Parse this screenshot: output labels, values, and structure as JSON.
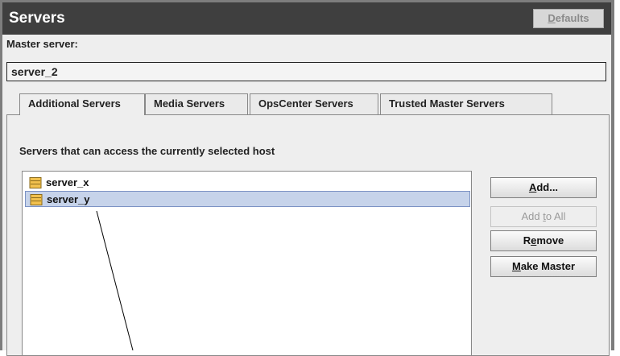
{
  "header": {
    "title": "Servers",
    "defaults_label": "Defaults"
  },
  "master": {
    "label": "Master server:",
    "value": "server_2"
  },
  "tabs": [
    {
      "label": "Additional Servers",
      "active": true
    },
    {
      "label": "Media Servers",
      "active": false
    },
    {
      "label": "OpsCenter Servers",
      "active": false
    },
    {
      "label": "Trusted Master Servers",
      "active": false
    }
  ],
  "description": "Servers that can access the currently selected host",
  "servers": [
    {
      "name": "server_x",
      "icon": "server-icon",
      "selected": false
    },
    {
      "name": "server_y",
      "icon": "server-icon",
      "selected": true
    }
  ],
  "buttons": {
    "add": {
      "label": "Add...",
      "enabled": true
    },
    "add_to_all": {
      "label": "Add to All",
      "enabled": false
    },
    "remove": {
      "label": "Remove",
      "enabled": true
    },
    "make_master": {
      "label": "Make Master",
      "enabled": true
    }
  },
  "colors": {
    "header_bg": "#3f3f3f",
    "selection_bg": "#c6d3ea",
    "panel_bg": "#eeeeee"
  }
}
